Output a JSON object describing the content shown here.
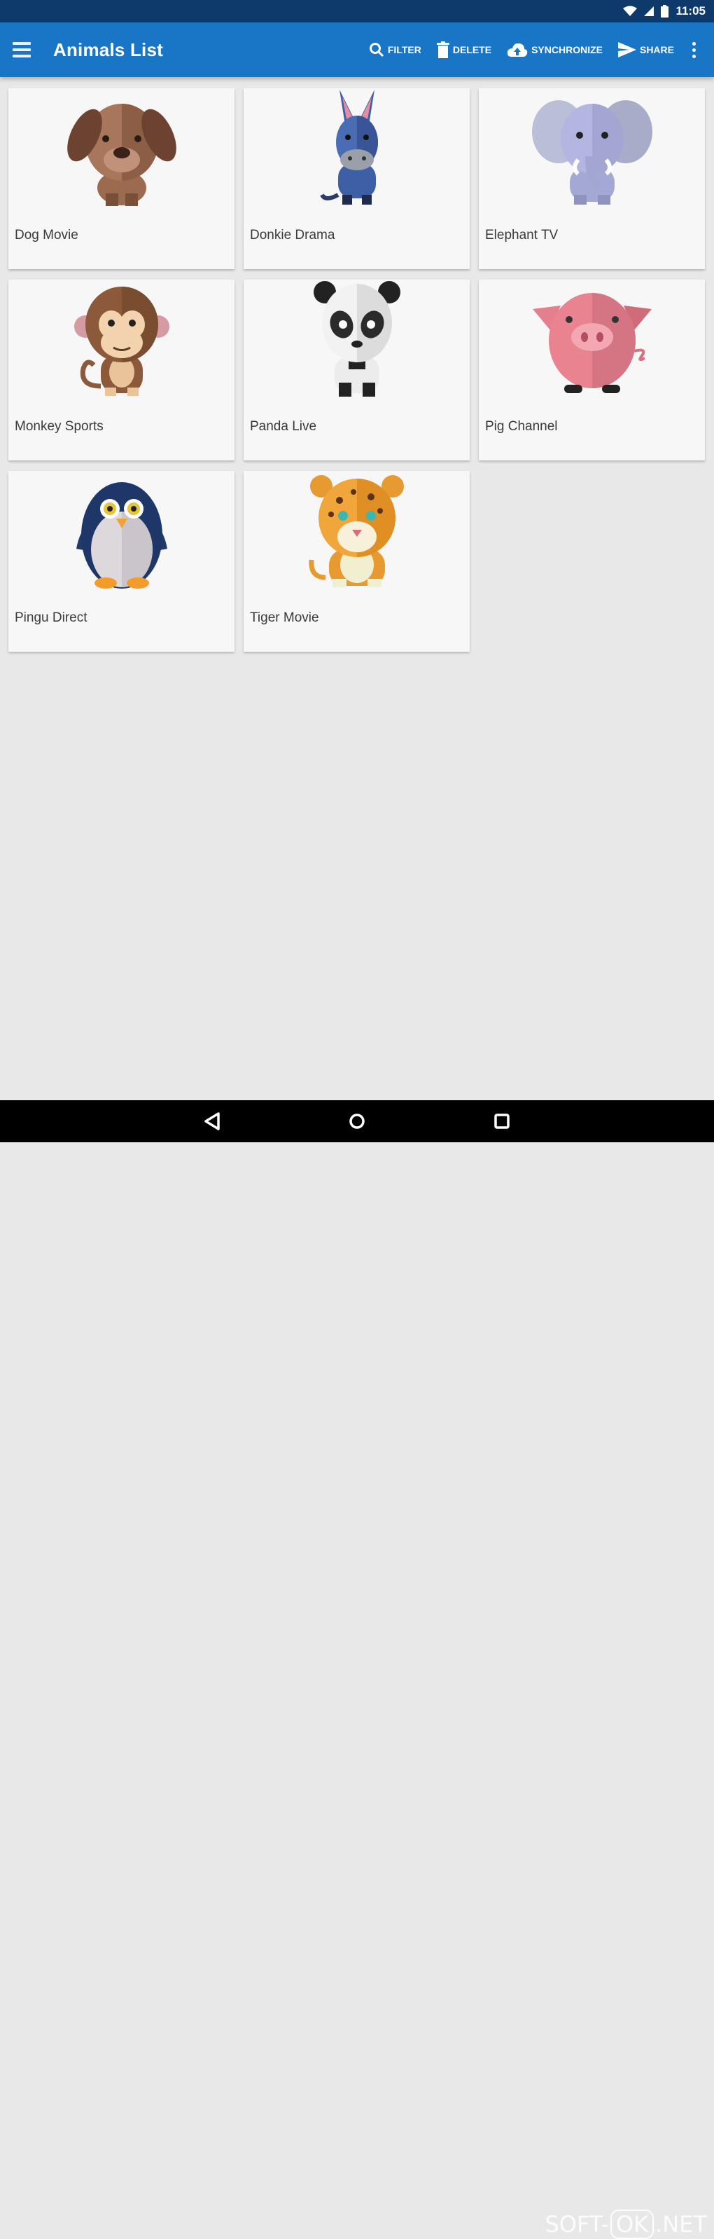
{
  "status_bar": {
    "time": "11:05"
  },
  "app_bar": {
    "title": "Animals List",
    "actions": [
      {
        "label": "Filter",
        "icon": "search-icon"
      },
      {
        "label": "Delete",
        "icon": "trash-icon"
      },
      {
        "label": "Synchronize",
        "icon": "cloud-upload-icon"
      },
      {
        "label": "Share",
        "icon": "send-icon"
      }
    ]
  },
  "cards": [
    {
      "label": "Dog Movie",
      "animal": "dog"
    },
    {
      "label": "Donkie Drama",
      "animal": "donkey"
    },
    {
      "label": "Elephant TV",
      "animal": "elephant"
    },
    {
      "label": "Monkey Sports",
      "animal": "monkey"
    },
    {
      "label": "Panda Live",
      "animal": "panda"
    },
    {
      "label": "Pig Channel",
      "animal": "pig"
    },
    {
      "label": "Pingu Direct",
      "animal": "penguin"
    },
    {
      "label": "Tiger Movie",
      "animal": "tiger"
    }
  ],
  "watermark": {
    "left": "SOFT-",
    "boxed": "OK",
    "right": ".NET"
  },
  "colors": {
    "primary": "#1976c7",
    "status_bar": "#0d3a6a",
    "background": "#e8e8e8",
    "card": "#f7f7f7"
  }
}
